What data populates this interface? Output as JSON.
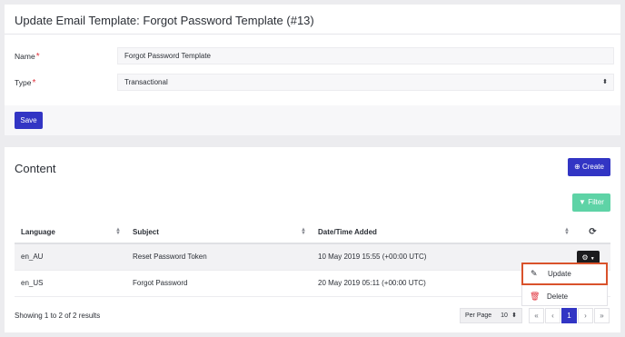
{
  "template_form": {
    "title": "Update Email Template: Forgot Password Template (#13)",
    "name_label": "Name",
    "name_value": "Forgot Password Template",
    "type_label": "Type",
    "type_value": "Transactional",
    "required_mark": "*",
    "save_label": "Save"
  },
  "content": {
    "title": "Content",
    "create_label": "Create",
    "filter_label": "Filter",
    "columns": [
      "Language",
      "Subject",
      "Date/Time Added"
    ],
    "rows": [
      {
        "language": "en_AU",
        "subject": "Reset Password Token",
        "date": "10 May 2019 15:55 (+00:00 UTC)"
      },
      {
        "language": "en_US",
        "subject": "Forgot Password",
        "date": "20 May 2019 05:11 (+00:00 UTC)"
      }
    ],
    "row_menu": {
      "update_label": "Update",
      "delete_label": "Delete"
    },
    "results_text": "Showing 1 to 2 of 2 results",
    "per_page_label": "Per Page",
    "per_page_value": "10",
    "pagination": {
      "first": "«",
      "prev": "‹",
      "current": "1",
      "next": "›",
      "last": "»"
    }
  },
  "colors": {
    "primary": "#3235c4",
    "filter": "#5ed3a6",
    "highlight_border": "#d9522b",
    "delete_icon": "#e0323c"
  },
  "icons": {
    "create": "plus-circle-icon",
    "filter": "funnel-icon",
    "refresh": "refresh-icon",
    "gear": "gear-icon",
    "update": "edit-icon",
    "delete": "trash-icon",
    "select": "sort-arrows-icon"
  }
}
